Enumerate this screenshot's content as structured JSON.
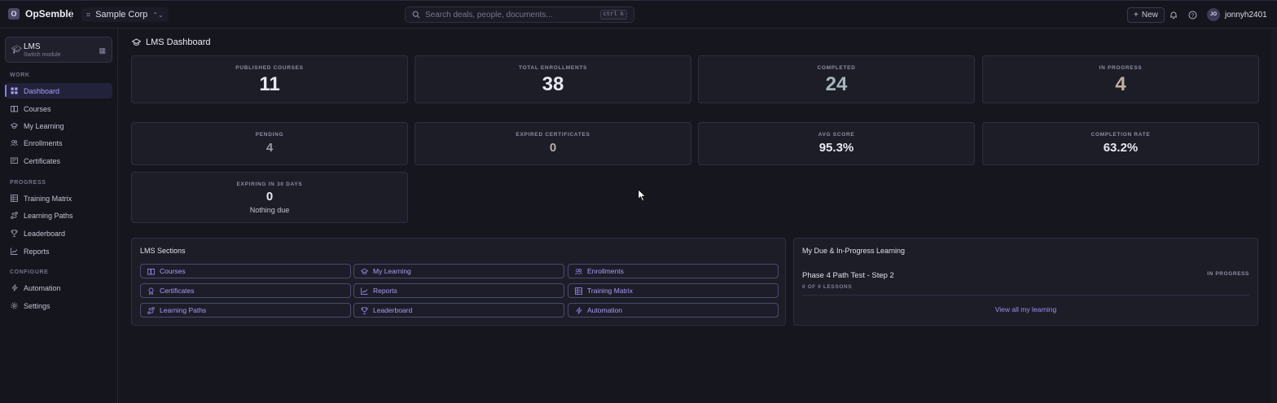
{
  "app": {
    "name": "OpSemble",
    "logo_letter": "O"
  },
  "org": {
    "name": "Sample Corp"
  },
  "search": {
    "placeholder": "Search deals, people, documents...",
    "shortcut": "ctrl k"
  },
  "header": {
    "new_label": "New",
    "user_initials": "JO",
    "user_name": "jonnyh2401"
  },
  "module": {
    "title": "LMS",
    "subtitle": "Switch module"
  },
  "sidebar": {
    "sections": [
      {
        "label": "WORK",
        "items": [
          {
            "label": "Dashboard",
            "icon": "grid-icon",
            "active": true
          },
          {
            "label": "Courses",
            "icon": "book-icon"
          },
          {
            "label": "My Learning",
            "icon": "graduation-cap-icon"
          },
          {
            "label": "Enrollments",
            "icon": "users-icon"
          },
          {
            "label": "Certificates",
            "icon": "certificate-icon"
          }
        ]
      },
      {
        "label": "PROGRESS",
        "items": [
          {
            "label": "Training Matrix",
            "icon": "table-icon"
          },
          {
            "label": "Learning Paths",
            "icon": "route-icon"
          },
          {
            "label": "Leaderboard",
            "icon": "trophy-icon"
          },
          {
            "label": "Reports",
            "icon": "chart-icon"
          }
        ]
      },
      {
        "label": "CONFIGURE",
        "items": [
          {
            "label": "Automation",
            "icon": "bolt-icon"
          },
          {
            "label": "Settings",
            "icon": "gear-icon"
          }
        ]
      }
    ]
  },
  "page": {
    "title": "LMS Dashboard"
  },
  "stats": {
    "published": {
      "label": "PUBLISHED COURSES",
      "value": "11",
      "color": "#e8e8f0"
    },
    "enrollments": {
      "label": "TOTAL ENROLLMENTS",
      "value": "38",
      "color": "#e8e8f0"
    },
    "completed": {
      "label": "COMPLETED",
      "value": "24",
      "color": "#a8b4be"
    },
    "in_progress": {
      "label": "IN PROGRESS",
      "value": "4",
      "color": "#c0b0a0"
    },
    "pending": {
      "label": "PENDING",
      "value": "4",
      "color": "#9a9aa6"
    },
    "expired": {
      "label": "EXPIRED CERTIFICATES",
      "value": "0",
      "color": "#b6b0a8"
    },
    "avg_score": {
      "label": "AVG SCORE",
      "value": "95.3%",
      "color": "#e8e8f0"
    },
    "completion_rate": {
      "label": "COMPLETION RATE",
      "value": "63.2%",
      "color": "#e8e8f0"
    },
    "expiring": {
      "label": "EXPIRING IN 30 DAYS",
      "value": "0",
      "note": "Nothing due",
      "color": "#e8e8f0"
    }
  },
  "sections_panel": {
    "title": "LMS Sections",
    "links": [
      {
        "label": "Courses",
        "icon": "book-icon"
      },
      {
        "label": "My Learning",
        "icon": "graduation-cap-icon"
      },
      {
        "label": "Enrollments",
        "icon": "users-icon"
      },
      {
        "label": "Certificates",
        "icon": "certificate-icon"
      },
      {
        "label": "Reports",
        "icon": "chart-icon"
      },
      {
        "label": "Training Matrix",
        "icon": "table-icon"
      },
      {
        "label": "Learning Paths",
        "icon": "route-icon"
      },
      {
        "label": "Leaderboard",
        "icon": "trophy-icon"
      },
      {
        "label": "Automation",
        "icon": "bolt-icon"
      }
    ]
  },
  "due_panel": {
    "title": "My Due & In-Progress Learning",
    "item": {
      "name": "Phase 4 Path Test - Step 2",
      "status": "IN PROGRESS",
      "lessons": "0 OF 0 LESSONS"
    },
    "view_all": "View all my learning"
  },
  "colors": {
    "accent": "#8a7cf0",
    "background": "#16161f",
    "card": "#1d1d28"
  }
}
